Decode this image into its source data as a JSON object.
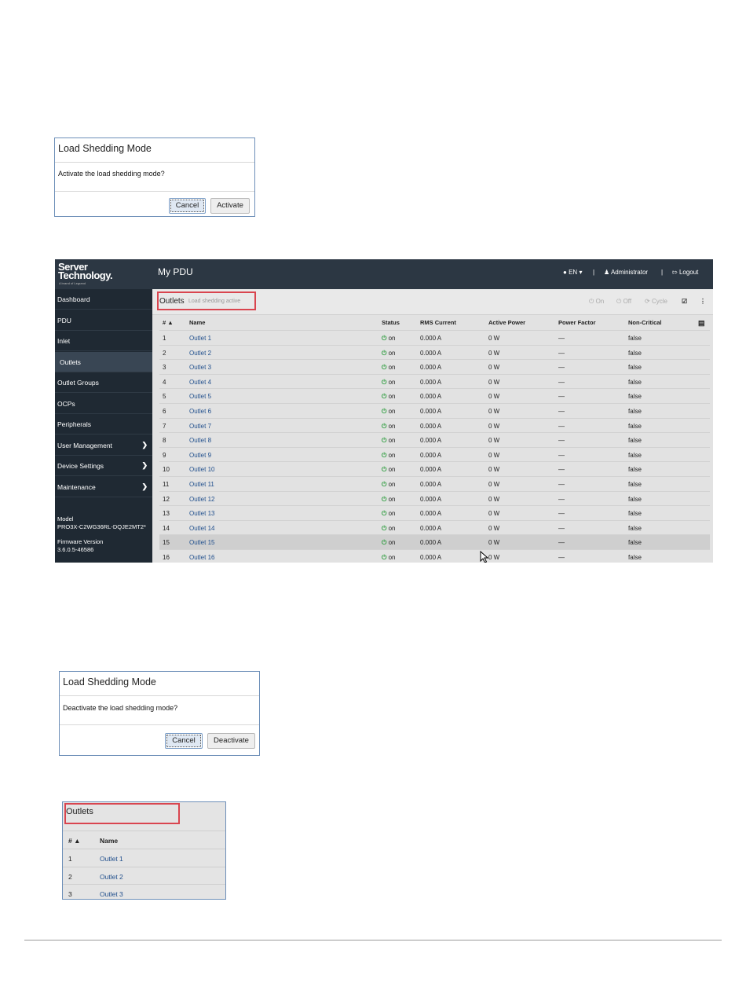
{
  "dialog_activate": {
    "title": "Load Shedding Mode",
    "message": "Activate the load shedding mode?",
    "cancel_label": "Cancel",
    "confirm_label": "Activate"
  },
  "app": {
    "logo_line1": "Server",
    "logo_line2": "Technology.",
    "logo_tagline": "A brand of Legrand",
    "title": "My PDU",
    "language": "EN",
    "user": "Administrator",
    "logout": "Logout",
    "sidebar": {
      "items": [
        {
          "label": "Dashboard"
        },
        {
          "label": "PDU"
        },
        {
          "label": "Inlet"
        },
        {
          "label": "Outlets"
        },
        {
          "label": "Outlet Groups"
        },
        {
          "label": "OCPs"
        },
        {
          "label": "Peripherals"
        },
        {
          "label": "User Management"
        },
        {
          "label": "Device Settings"
        },
        {
          "label": "Maintenance"
        }
      ],
      "model_label": "Model",
      "model_value": "PRO3X-C2WG36RL-DQJE2MT2*",
      "firmware_label": "Firmware Version",
      "firmware_value": "3.6.0.5-46586"
    },
    "header": {
      "title": "Outlets",
      "subtitle": "Load shedding active",
      "on_label": "On",
      "off_label": "Off",
      "cycle_label": "Cycle"
    },
    "table": {
      "columns": [
        "# ▲",
        "Name",
        "Status",
        "RMS Current",
        "Active Power",
        "Power Factor",
        "Non-Critical"
      ],
      "rows": [
        {
          "num": "1",
          "name": "Outlet 1",
          "status": "on",
          "current": "0.000 A",
          "power": "0 W",
          "pf": "—",
          "nc": "false"
        },
        {
          "num": "2",
          "name": "Outlet 2",
          "status": "on",
          "current": "0.000 A",
          "power": "0 W",
          "pf": "—",
          "nc": "false"
        },
        {
          "num": "3",
          "name": "Outlet 3",
          "status": "on",
          "current": "0.000 A",
          "power": "0 W",
          "pf": "—",
          "nc": "false"
        },
        {
          "num": "4",
          "name": "Outlet 4",
          "status": "on",
          "current": "0.000 A",
          "power": "0 W",
          "pf": "—",
          "nc": "false"
        },
        {
          "num": "5",
          "name": "Outlet 5",
          "status": "on",
          "current": "0.000 A",
          "power": "0 W",
          "pf": "—",
          "nc": "false"
        },
        {
          "num": "6",
          "name": "Outlet 6",
          "status": "on",
          "current": "0.000 A",
          "power": "0 W",
          "pf": "—",
          "nc": "false"
        },
        {
          "num": "7",
          "name": "Outlet 7",
          "status": "on",
          "current": "0.000 A",
          "power": "0 W",
          "pf": "—",
          "nc": "false"
        },
        {
          "num": "8",
          "name": "Outlet 8",
          "status": "on",
          "current": "0.000 A",
          "power": "0 W",
          "pf": "—",
          "nc": "false"
        },
        {
          "num": "9",
          "name": "Outlet 9",
          "status": "on",
          "current": "0.000 A",
          "power": "0 W",
          "pf": "—",
          "nc": "false"
        },
        {
          "num": "10",
          "name": "Outlet 10",
          "status": "on",
          "current": "0.000 A",
          "power": "0 W",
          "pf": "—",
          "nc": "false"
        },
        {
          "num": "11",
          "name": "Outlet 11",
          "status": "on",
          "current": "0.000 A",
          "power": "0 W",
          "pf": "—",
          "nc": "false"
        },
        {
          "num": "12",
          "name": "Outlet 12",
          "status": "on",
          "current": "0.000 A",
          "power": "0 W",
          "pf": "—",
          "nc": "false"
        },
        {
          "num": "13",
          "name": "Outlet 13",
          "status": "on",
          "current": "0.000 A",
          "power": "0 W",
          "pf": "—",
          "nc": "false"
        },
        {
          "num": "14",
          "name": "Outlet 14",
          "status": "on",
          "current": "0.000 A",
          "power": "0 W",
          "pf": "—",
          "nc": "false"
        },
        {
          "num": "15",
          "name": "Outlet 15",
          "status": "on",
          "current": "0.000 A",
          "power": "0 W",
          "pf": "—",
          "nc": "false"
        },
        {
          "num": "16",
          "name": "Outlet 16",
          "status": "on",
          "current": "0.000 A",
          "power": "0 W",
          "pf": "—",
          "nc": "false"
        }
      ]
    }
  },
  "dialog_deactivate": {
    "title": "Load Shedding Mode",
    "message": "Deactivate the load shedding mode?",
    "cancel_label": "Cancel",
    "confirm_label": "Deactivate"
  },
  "snippet": {
    "title": "Outlets",
    "columns": [
      "# ▲",
      "Name"
    ],
    "rows": [
      {
        "num": "1",
        "name": "Outlet 1"
      },
      {
        "num": "2",
        "name": "Outlet 2"
      },
      {
        "num": "3",
        "name": "Outlet 3"
      }
    ]
  },
  "colors": {
    "topbar": "#2c3743",
    "sidebar": "#1f2933",
    "highlight": "#d9454f",
    "link": "#1f4e8c",
    "status_on": "#2e9d3f"
  }
}
